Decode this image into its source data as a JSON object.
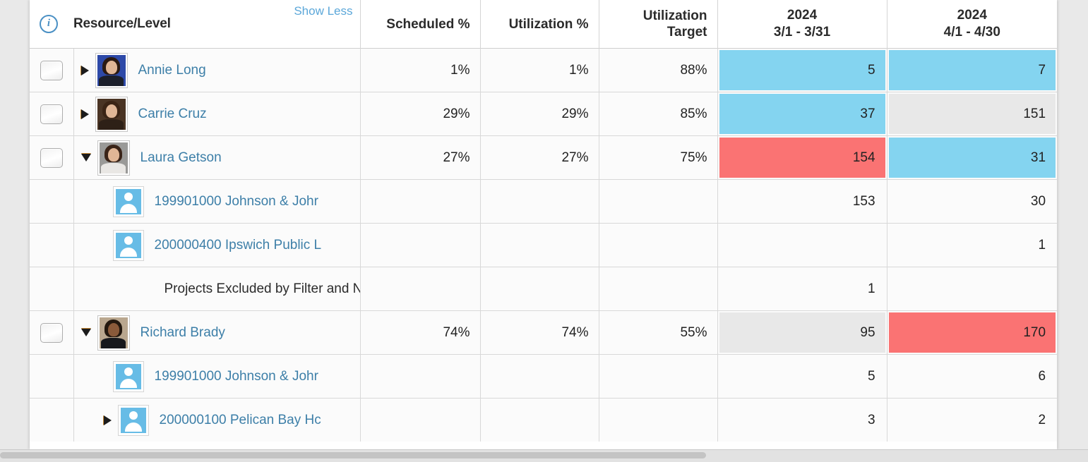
{
  "header": {
    "info_icon": "info-circle-icon",
    "resource_label": "Resource/Level",
    "show_less_label": "Show Less",
    "scheduled_label": "Scheduled %",
    "utilization_label": "Utilization %",
    "utilization_target_line1": "Utilization",
    "utilization_target_line2": "Target",
    "period1_year": "2024",
    "period1_range": "3/1 - 3/31",
    "period2_year": "2024",
    "period2_range": "4/1 - 4/30"
  },
  "colors": {
    "link": "#3d7fa8",
    "show_less": "#5ba7d9",
    "blue_cell": "#84d4f0",
    "red_cell": "#fa7373",
    "gray_cell": "#e8e8e8",
    "avatar_blue": "#67bce6",
    "info_icon": "#4a90c4"
  },
  "rows": [
    {
      "kind": "resource",
      "checkbox": true,
      "expander": "collapsed",
      "avatar": "photo-annie-long",
      "name": "Annie Long",
      "scheduled": "1%",
      "utilization": "1%",
      "target": "88%",
      "p1": "5",
      "p1_state": "blue",
      "p2": "7",
      "p2_state": "blue"
    },
    {
      "kind": "resource",
      "checkbox": true,
      "expander": "collapsed",
      "avatar": "photo-carrie-cruz",
      "name": "Carrie Cruz",
      "scheduled": "29%",
      "utilization": "29%",
      "target": "85%",
      "p1": "37",
      "p1_state": "blue",
      "p2": "151",
      "p2_state": "gray"
    },
    {
      "kind": "resource",
      "checkbox": true,
      "expander": "expanded",
      "avatar": "photo-laura-getson",
      "name": "Laura Getson",
      "scheduled": "27%",
      "utilization": "27%",
      "target": "75%",
      "p1": "154",
      "p1_state": "red",
      "p2": "31",
      "p2_state": "blue"
    },
    {
      "kind": "project",
      "checkbox": false,
      "expander": "none",
      "avatar": "project-glyph-icon",
      "name": "199901000 Johnson & Johr",
      "scheduled": "",
      "utilization": "",
      "target": "",
      "p1": "153",
      "p1_state": "none",
      "p2": "30",
      "p2_state": "none"
    },
    {
      "kind": "project",
      "checkbox": false,
      "expander": "none",
      "avatar": "project-glyph-icon",
      "name": "200000400 Ipswich Public L",
      "scheduled": "",
      "utilization": "",
      "target": "",
      "p1": "",
      "p1_state": "none",
      "p2": "1",
      "p2_state": "none"
    },
    {
      "kind": "note",
      "checkbox": false,
      "expander": "none",
      "avatar": "",
      "name": "Projects Excluded by Filter and N",
      "scheduled": "",
      "utilization": "",
      "target": "",
      "p1": "1",
      "p1_state": "none",
      "p2": "",
      "p2_state": "none"
    },
    {
      "kind": "resource",
      "checkbox": true,
      "expander": "expanded",
      "avatar": "photo-richard-brady",
      "name": "Richard Brady",
      "scheduled": "74%",
      "utilization": "74%",
      "target": "55%",
      "p1": "95",
      "p1_state": "gray",
      "p2": "170",
      "p2_state": "red"
    },
    {
      "kind": "project",
      "checkbox": false,
      "expander": "none",
      "avatar": "project-glyph-icon",
      "name": "199901000 Johnson & Johr",
      "scheduled": "",
      "utilization": "",
      "target": "",
      "p1": "5",
      "p1_state": "none",
      "p2": "6",
      "p2_state": "none"
    },
    {
      "kind": "project",
      "checkbox": false,
      "expander": "collapsed",
      "avatar": "project-glyph-icon",
      "name": "200000100 Pelican Bay Hc",
      "scheduled": "",
      "utilization": "",
      "target": "",
      "p1": "3",
      "p1_state": "none",
      "p2": "2",
      "p2_state": "none"
    }
  ]
}
